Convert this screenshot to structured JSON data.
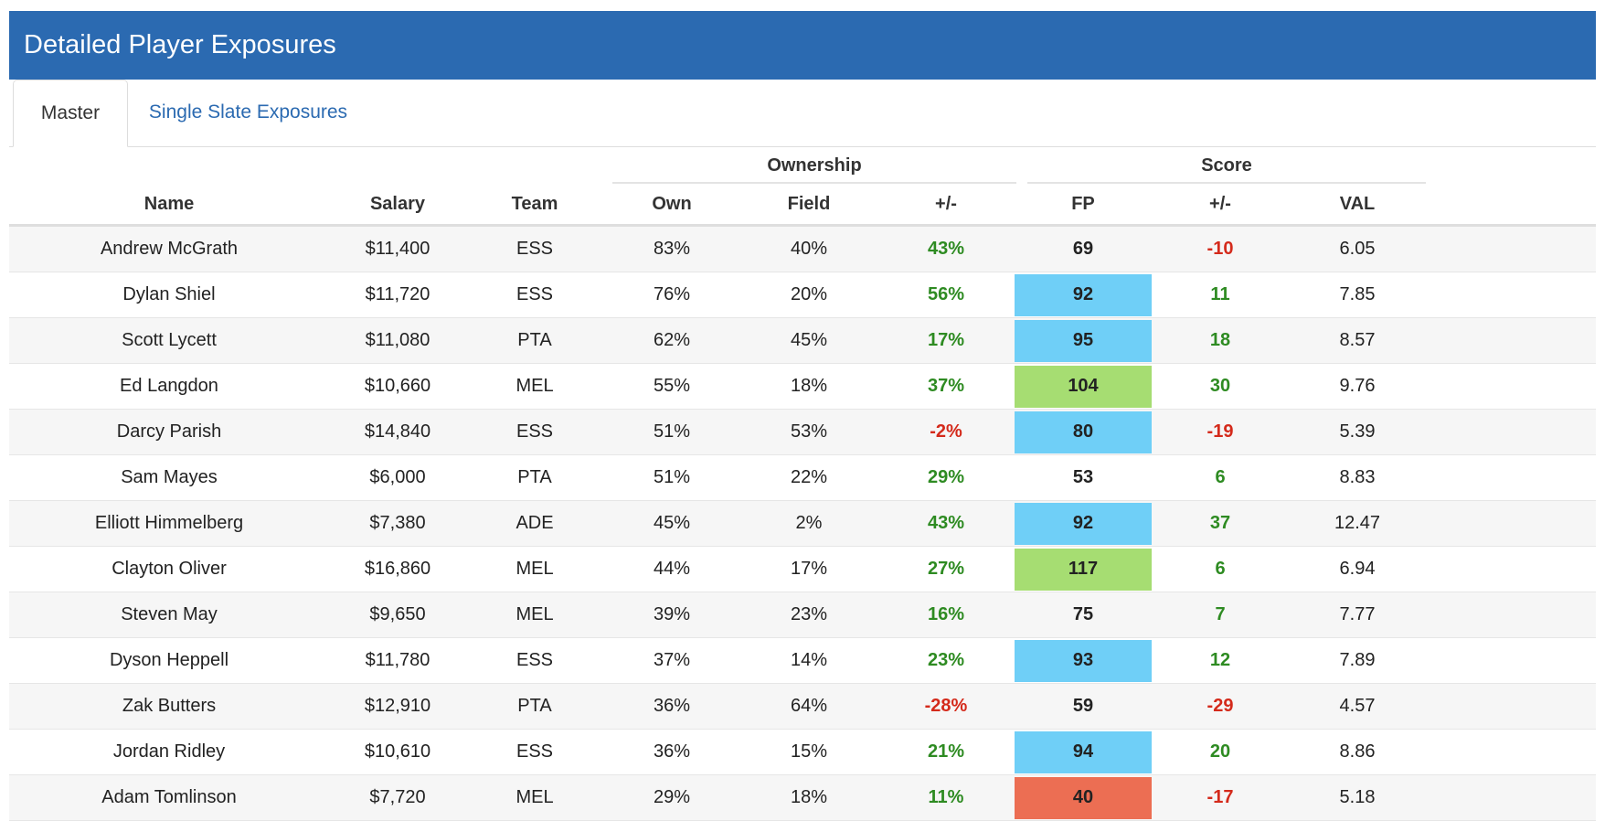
{
  "header": {
    "title": "Detailed Player Exposures"
  },
  "tabs": [
    {
      "label": "Master"
    },
    {
      "label": "Single Slate Exposures"
    }
  ],
  "groups": {
    "ownership": "Ownership",
    "score": "Score"
  },
  "columns": {
    "name": "Name",
    "salary": "Salary",
    "team": "Team",
    "own": "Own",
    "field": "Field",
    "own_pm": "+/-",
    "fp": "FP",
    "score_pm": "+/-",
    "val": "VAL"
  },
  "colors": {
    "header": "#2b6ab1",
    "fp_blue": "#6fcff7",
    "fp_green": "#a6dd72",
    "fp_red": "#ec6e53",
    "positive": "#2e8b22",
    "negative": "#d42a1b"
  },
  "rows": [
    {
      "name": "Andrew McGrath",
      "salary": "$11,400",
      "team": "ESS",
      "own": "83%",
      "field": "40%",
      "own_pm": "43%",
      "own_sign": "pos",
      "fp": "69",
      "fp_color": "",
      "score_pm": "-10",
      "score_sign": "neg",
      "val": "6.05"
    },
    {
      "name": "Dylan Shiel",
      "salary": "$11,720",
      "team": "ESS",
      "own": "76%",
      "field": "20%",
      "own_pm": "56%",
      "own_sign": "pos",
      "fp": "92",
      "fp_color": "#6fcff7",
      "score_pm": "11",
      "score_sign": "pos",
      "val": "7.85"
    },
    {
      "name": "Scott Lycett",
      "salary": "$11,080",
      "team": "PTA",
      "own": "62%",
      "field": "45%",
      "own_pm": "17%",
      "own_sign": "pos",
      "fp": "95",
      "fp_color": "#6fcff7",
      "score_pm": "18",
      "score_sign": "pos",
      "val": "8.57"
    },
    {
      "name": "Ed Langdon",
      "salary": "$10,660",
      "team": "MEL",
      "own": "55%",
      "field": "18%",
      "own_pm": "37%",
      "own_sign": "pos",
      "fp": "104",
      "fp_color": "#a6dd72",
      "score_pm": "30",
      "score_sign": "pos",
      "val": "9.76"
    },
    {
      "name": "Darcy Parish",
      "salary": "$14,840",
      "team": "ESS",
      "own": "51%",
      "field": "53%",
      "own_pm": "-2%",
      "own_sign": "neg",
      "fp": "80",
      "fp_color": "#6fcff7",
      "score_pm": "-19",
      "score_sign": "neg",
      "val": "5.39"
    },
    {
      "name": "Sam Mayes",
      "salary": "$6,000",
      "team": "PTA",
      "own": "51%",
      "field": "22%",
      "own_pm": "29%",
      "own_sign": "pos",
      "fp": "53",
      "fp_color": "",
      "score_pm": "6",
      "score_sign": "pos",
      "val": "8.83"
    },
    {
      "name": "Elliott Himmelberg",
      "salary": "$7,380",
      "team": "ADE",
      "own": "45%",
      "field": "2%",
      "own_pm": "43%",
      "own_sign": "pos",
      "fp": "92",
      "fp_color": "#6fcff7",
      "score_pm": "37",
      "score_sign": "pos",
      "val": "12.47"
    },
    {
      "name": "Clayton Oliver",
      "salary": "$16,860",
      "team": "MEL",
      "own": "44%",
      "field": "17%",
      "own_pm": "27%",
      "own_sign": "pos",
      "fp": "117",
      "fp_color": "#a6dd72",
      "score_pm": "6",
      "score_sign": "pos",
      "val": "6.94"
    },
    {
      "name": "Steven May",
      "salary": "$9,650",
      "team": "MEL",
      "own": "39%",
      "field": "23%",
      "own_pm": "16%",
      "own_sign": "pos",
      "fp": "75",
      "fp_color": "",
      "score_pm": "7",
      "score_sign": "pos",
      "val": "7.77"
    },
    {
      "name": "Dyson Heppell",
      "salary": "$11,780",
      "team": "ESS",
      "own": "37%",
      "field": "14%",
      "own_pm": "23%",
      "own_sign": "pos",
      "fp": "93",
      "fp_color": "#6fcff7",
      "score_pm": "12",
      "score_sign": "pos",
      "val": "7.89"
    },
    {
      "name": "Zak Butters",
      "salary": "$12,910",
      "team": "PTA",
      "own": "36%",
      "field": "64%",
      "own_pm": "-28%",
      "own_sign": "neg",
      "fp": "59",
      "fp_color": "",
      "score_pm": "-29",
      "score_sign": "neg",
      "val": "4.57"
    },
    {
      "name": "Jordan Ridley",
      "salary": "$10,610",
      "team": "ESS",
      "own": "36%",
      "field": "15%",
      "own_pm": "21%",
      "own_sign": "pos",
      "fp": "94",
      "fp_color": "#6fcff7",
      "score_pm": "20",
      "score_sign": "pos",
      "val": "8.86"
    },
    {
      "name": "Adam Tomlinson",
      "salary": "$7,720",
      "team": "MEL",
      "own": "29%",
      "field": "18%",
      "own_pm": "11%",
      "own_sign": "pos",
      "fp": "40",
      "fp_color": "#ec6e53",
      "score_pm": "-17",
      "score_sign": "neg",
      "val": "5.18"
    }
  ]
}
